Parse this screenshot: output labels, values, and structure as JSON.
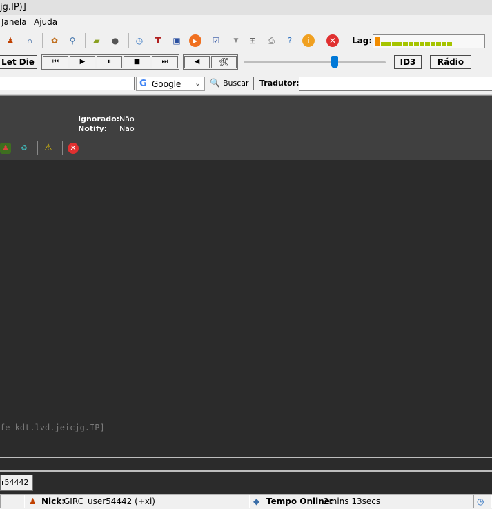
{
  "window": {
    "title_fragment": "jg.IP)]"
  },
  "menu": {
    "items": [
      "Janela",
      "Ajuda"
    ]
  },
  "toolbar": {
    "icons": [
      "users-icon",
      "trash-icon",
      "palette-icon",
      "search-tool-icon",
      "folder-icon",
      "user-icon",
      "clock-icon",
      "text-tool-icon",
      "monitor-icon",
      "play-media-icon",
      "checklist-icon",
      "network-icon",
      "printer-icon",
      "help-icon",
      "info-icon",
      "close-icon"
    ],
    "lag_label": "Lag:",
    "lag_bars": [
      0.9,
      0.4,
      0.4,
      0.4,
      0.4,
      0.4,
      0.4,
      0.4,
      0.4,
      0.4,
      0.4,
      0.4,
      0.4,
      0.4
    ]
  },
  "media": {
    "song": "Let Die",
    "prev": "⏮",
    "play": "▶",
    "pause": "⏸",
    "stop": "■",
    "next": "⏭",
    "mute": "◀",
    "tools": "🛠",
    "volume": 0.64,
    "id3_label": "ID3",
    "radio_label": "Rádio"
  },
  "search": {
    "engine": "Google",
    "engine_logo": "G",
    "button_label": "Buscar",
    "translator_label": "Tradutor:",
    "query_value": "",
    "translator_value": ""
  },
  "info": {
    "ignored_label": "Ignorado:",
    "ignored_value": "Não",
    "notify_label": "Notify:",
    "notify_value": "Não"
  },
  "chat": {
    "line": "fe-kdt.lvd.jeicjg.IP]"
  },
  "switchbar": {
    "active_tab": "r54442"
  },
  "status": {
    "nick_label": "Nick:",
    "nick_value": "GIRC_user54442 (+xi)",
    "online_label": "Tempo Online:",
    "online_value": "2mins 13secs"
  },
  "colors": {
    "accent": "#0078d7",
    "dark_bg": "#2b2b2b",
    "header_bg": "#404040",
    "lag_orange": "#f28c00",
    "lag_green": "#a6c400"
  }
}
